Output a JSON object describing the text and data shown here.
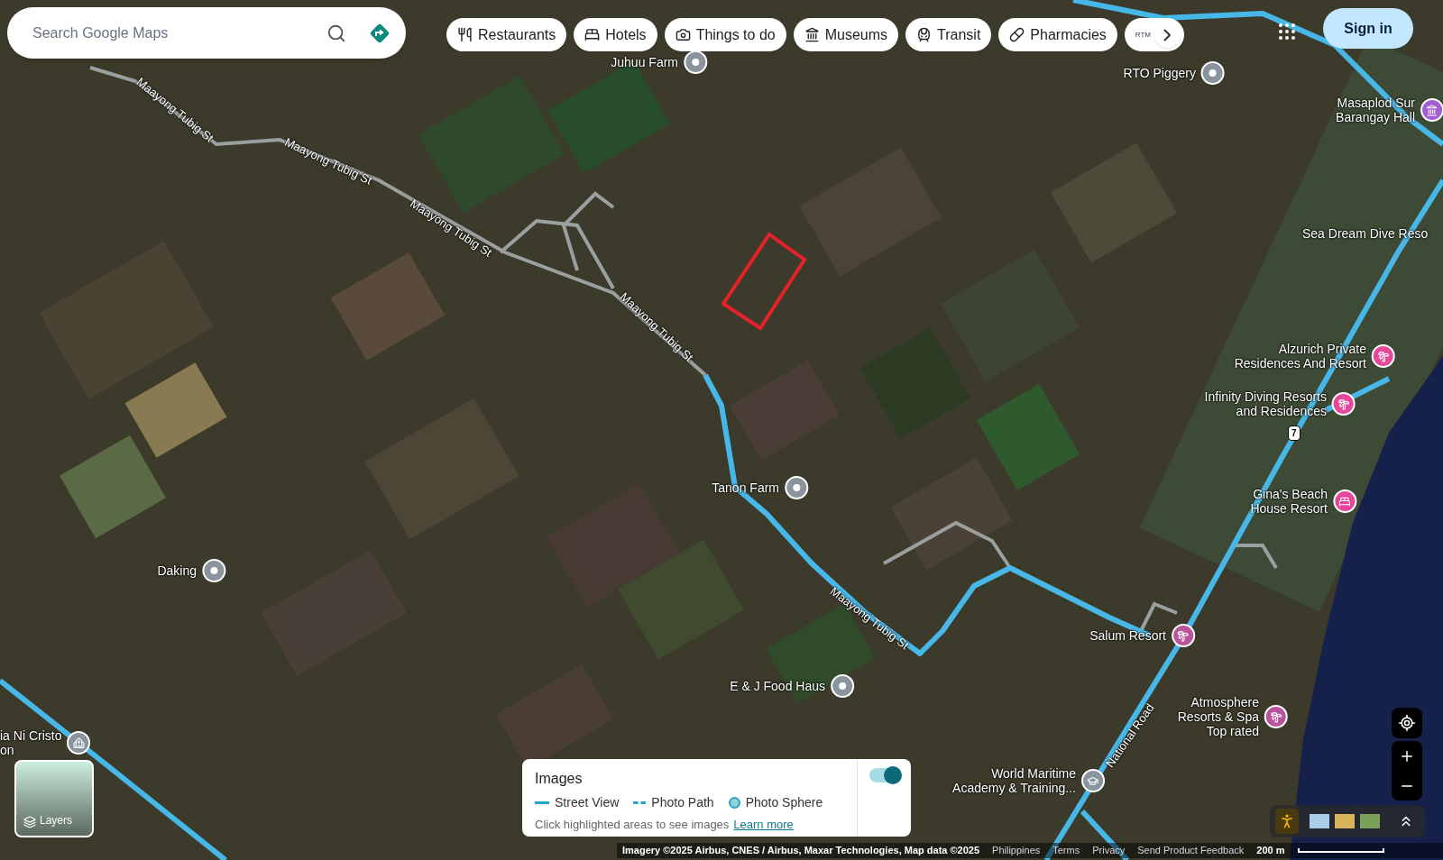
{
  "search": {
    "placeholder": "Search Google Maps"
  },
  "chips": [
    {
      "label": "Restaurants",
      "kind": "restaurant"
    },
    {
      "label": "Hotels",
      "kind": "hotel"
    },
    {
      "label": "Things to do",
      "kind": "camera"
    },
    {
      "label": "Museums",
      "kind": "museum"
    },
    {
      "label": "Transit",
      "kind": "transit"
    },
    {
      "label": "Pharmacies",
      "kind": "pharmacy"
    },
    {
      "label": "RTM",
      "kind": "partial"
    }
  ],
  "sign_in": "Sign in",
  "places": [
    {
      "lines": [
        "Juhuu Farm"
      ],
      "kind": "generic",
      "color": "#8a949c"
    },
    {
      "lines": [
        "RTO Piggery"
      ],
      "kind": "generic",
      "color": "#8a949c"
    },
    {
      "lines": [
        "Masaplod Sur",
        "Barangay Hall"
      ],
      "kind": "hall",
      "color": "#a35fd1"
    },
    {
      "lines": [
        "Sea Dream Dive Reso"
      ],
      "kind": "label"
    },
    {
      "lines": [
        "Alzurich Private",
        "Residences And Resort"
      ],
      "kind": "resort",
      "color": "#e5479b"
    },
    {
      "lines": [
        "Infinity Diving Resorts",
        "and Residences"
      ],
      "kind": "resort",
      "color": "#e5479b"
    },
    {
      "lines": [
        "Gina's Beach",
        "House Resort"
      ],
      "kind": "hotel",
      "color": "#e5479b"
    },
    {
      "lines": [
        "Tanon Farm"
      ],
      "kind": "generic",
      "color": "#8a949c"
    },
    {
      "lines": [
        "Daking"
      ],
      "kind": "generic",
      "color": "#8a949c"
    },
    {
      "lines": [
        "E & J Food Haus"
      ],
      "kind": "generic",
      "color": "#8a949c"
    },
    {
      "lines": [
        "Salum Resort"
      ],
      "kind": "resort",
      "color": "#b9549b"
    },
    {
      "lines": [
        "Atmosphere",
        "Resorts & Spa",
        "Top rated"
      ],
      "kind": "resort",
      "color": "#b9549b"
    },
    {
      "lines": [
        "World Maritime",
        "Academy & Training..."
      ],
      "kind": "school",
      "color": "#8a949c"
    },
    {
      "lines": [
        "ia Ni Cristo",
        "on"
      ],
      "kind": "church",
      "color": "#8a949c"
    }
  ],
  "streets": [
    "Maayong Tubig St",
    "Maayong Tubig St",
    "Maayong Tubig St",
    "Maayong Tubig St",
    "Maayong Tubig St",
    "National Road"
  ],
  "route_shield": "7",
  "images_panel": {
    "title": "Images",
    "legend": [
      {
        "label": "Street View",
        "kind": "line"
      },
      {
        "label": "Photo Path",
        "kind": "dash"
      },
      {
        "label": "Photo Sphere",
        "kind": "sphere"
      }
    ],
    "hint": "Click highlighted areas to see images",
    "link": "Learn more",
    "on": true
  },
  "layers": "Layers",
  "footer": {
    "attribution": "Imagery ©2025 Airbus, CNES / Airbus, Maxar Technologies, Map data ©2025",
    "links": [
      "Philippines",
      "Terms",
      "Privacy",
      "Send Product Feedback"
    ],
    "scale": "200 m"
  }
}
